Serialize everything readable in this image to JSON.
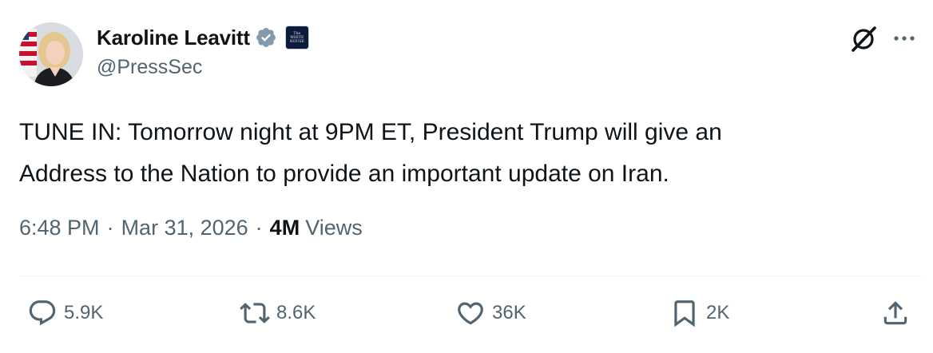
{
  "author": {
    "display_name": "Karoline Leavitt",
    "handle": "@PressSec",
    "verified_badge_color": "#829aab",
    "affiliate_badge": {
      "icon": "white-house-badge-icon",
      "text_lines": [
        "The",
        "WHITE",
        "HOUSE"
      ]
    }
  },
  "header_actions": {
    "grok_icon": "grok-icon",
    "more_icon": "more-horizontal-icon"
  },
  "tweet": {
    "text": "TUNE IN: Tomorrow night at 9PM ET, President Trump will give an\nAddress to the Nation to provide an important update on Iran."
  },
  "meta": {
    "time": "6:48 PM",
    "separator": "·",
    "date": "Mar 31, 2026",
    "views_count": "4M",
    "views_label": "Views"
  },
  "actions": {
    "reply": {
      "icon": "reply-icon",
      "count": "5.9K"
    },
    "repost": {
      "icon": "repost-icon",
      "count": "8.6K"
    },
    "like": {
      "icon": "heart-icon",
      "count": "36K"
    },
    "bookmark": {
      "icon": "bookmark-icon",
      "count": "2K"
    },
    "share": {
      "icon": "share-icon"
    }
  },
  "colors": {
    "text_primary": "#0f1419",
    "text_secondary": "#536471",
    "divider": "#eff3f4"
  }
}
